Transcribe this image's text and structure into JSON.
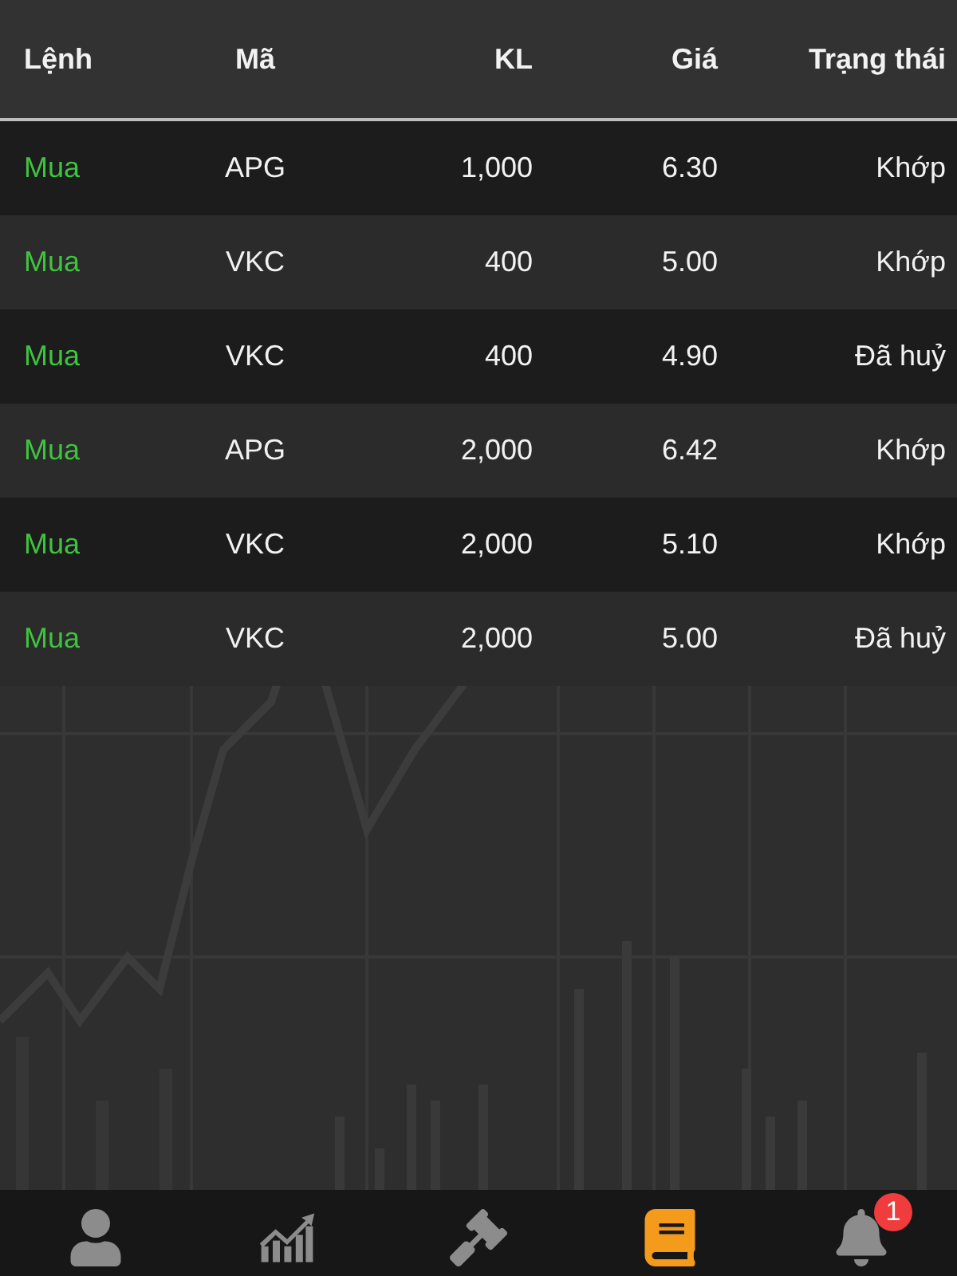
{
  "table": {
    "columns": [
      "Lệnh",
      "Mã",
      "KL",
      "Giá",
      "Trạng thái"
    ],
    "rows": [
      {
        "side": "Mua",
        "code": "APG",
        "volume": "1,000",
        "price": "6.30",
        "status": "Khớp"
      },
      {
        "side": "Mua",
        "code": "VKC",
        "volume": "400",
        "price": "5.00",
        "status": "Khớp"
      },
      {
        "side": "Mua",
        "code": "VKC",
        "volume": "400",
        "price": "4.90",
        "status": "Đã huỷ"
      },
      {
        "side": "Mua",
        "code": "APG",
        "volume": "2,000",
        "price": "6.42",
        "status": "Khớp"
      },
      {
        "side": "Mua",
        "code": "VKC",
        "volume": "2,000",
        "price": "5.10",
        "status": "Khớp"
      },
      {
        "side": "Mua",
        "code": "VKC",
        "volume": "2,000",
        "price": "5.00",
        "status": "Đã huỷ"
      }
    ]
  },
  "tab_bar": {
    "tabs": [
      {
        "selected": false
      },
      {
        "selected": false
      },
      {
        "selected": false
      },
      {
        "selected": true
      },
      {
        "selected": false,
        "badge": "1"
      }
    ]
  }
}
